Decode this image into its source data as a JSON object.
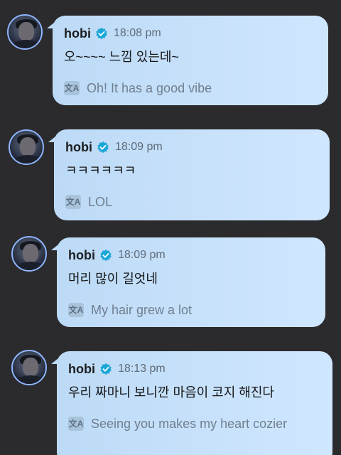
{
  "colors": {
    "background": "#2b2b2e",
    "bubble": "#c9e2fb",
    "verified": "#1aa7d8"
  },
  "messages": [
    {
      "author": "hobi",
      "verified_icon": "verified-check-icon",
      "time": "18:08 pm",
      "text": "오~~~~ 느낌 있는데~",
      "translation_icon": "translate-icon",
      "translation": "Oh! It has a good vibe"
    },
    {
      "author": "hobi",
      "verified_icon": "verified-check-icon",
      "time": "18:09 pm",
      "text": "ㅋㅋㅋㅋㅋㅋ",
      "translation_icon": "translate-icon",
      "translation": "LOL"
    },
    {
      "author": "hobi",
      "verified_icon": "verified-check-icon",
      "time": "18:09 pm",
      "text": "머리 많이 길엇네",
      "translation_icon": "translate-icon",
      "translation": "My hair grew a lot"
    },
    {
      "author": "hobi",
      "verified_icon": "verified-check-icon",
      "time": "18:13 pm",
      "text": "우리 짜마니 보니깐 마음이 코지 해진다",
      "translation_icon": "translate-icon",
      "translation": "Seeing you makes my heart cozier"
    }
  ]
}
